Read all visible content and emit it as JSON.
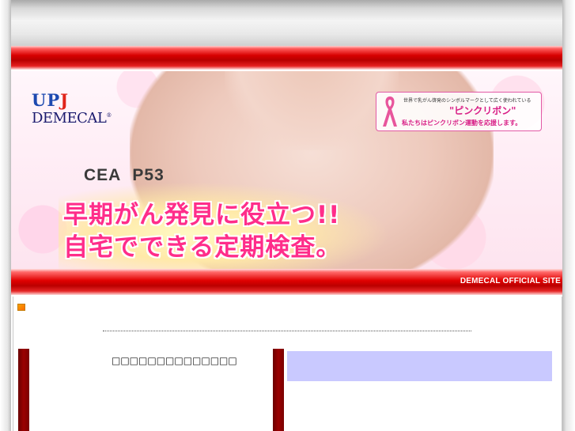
{
  "banner": {
    "logo_top": "UP",
    "logo_top_red": "J",
    "logo_bottom": "DEMECAL",
    "logo_reg": "®",
    "ribbon": {
      "line1": "世界で乳がん啓発のシンボルマークとして広く使われている",
      "line2": "\"ピンクリボン\"",
      "line3": "私たちはピンクリボン運動を応援します。"
    },
    "markers": "CEA P53",
    "headline_1": "早期がん発見に役立つ!!",
    "headline_2": "自宅でできる定期検査。"
  },
  "nav": {
    "official_site": "DEMECAL OFFICIAL SITE"
  },
  "content": {
    "left_title": "□□□□□□□□□□□□□□"
  },
  "colors": {
    "brand_red": "#cc0000",
    "headline_pink": "#ff2d8a",
    "panel_lavender": "#c9c9ff",
    "column_bar": "#8b0000"
  }
}
